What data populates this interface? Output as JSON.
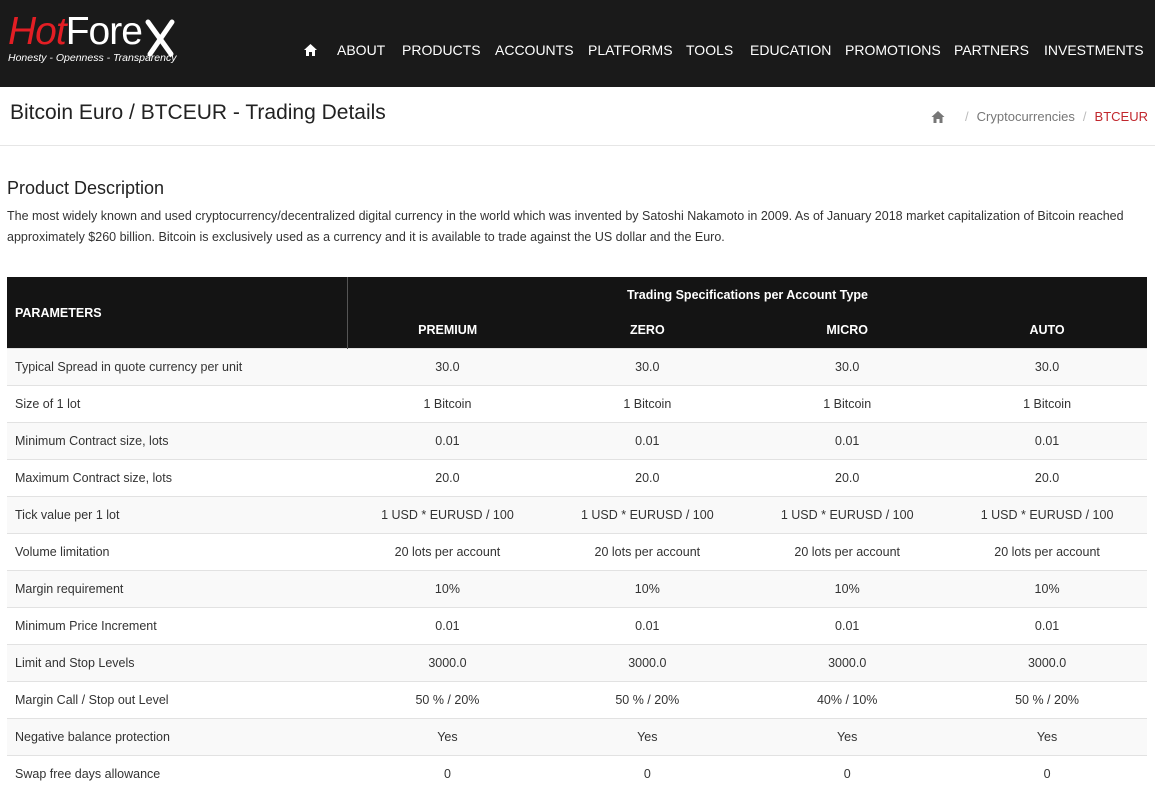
{
  "brand": {
    "logo_hot": "Hot",
    "logo_forex": "Fore",
    "logo_x": "X",
    "tagline": "Honesty - Openness - Transparency"
  },
  "nav": {
    "home_icon": "home-icon",
    "items": [
      "ABOUT",
      "PRODUCTS",
      "ACCOUNTS",
      "PLATFORMS",
      "TOOLS",
      "EDUCATION",
      "PROMOTIONS",
      "PARTNERS",
      "INVESTMENTS"
    ]
  },
  "page": {
    "title": "Bitcoin Euro / BTCEUR - Trading Details"
  },
  "breadcrumb": {
    "home_icon": "home-icon",
    "separator": "/",
    "items": [
      "Cryptocurrencies",
      "BTCEUR"
    ]
  },
  "description": {
    "heading": "Product Description",
    "text": "The most widely known and used cryptocurrency/decentralized digital currency in the world which was invented by Satoshi Nakamoto in 2009. As of January 2018 market capitalization of Bitcoin reached approximately $260 billion. Bitcoin is exclusively used as a currency and it is available to trade against the US dollar and the Euro."
  },
  "table": {
    "params_header": "PARAMETERS",
    "group_header": "Trading Specifications per Account Type",
    "columns": [
      "PREMIUM",
      "ZERO",
      "MICRO",
      "AUTO"
    ],
    "rows": [
      {
        "param": "Typical Spread in quote currency per unit",
        "values": [
          "30.0",
          "30.0",
          "30.0",
          "30.0"
        ]
      },
      {
        "param": "Size of 1 lot",
        "values": [
          "1 Bitcoin",
          "1 Bitcoin",
          "1 Bitcoin",
          "1 Bitcoin"
        ]
      },
      {
        "param": "Minimum Contract size, lots",
        "values": [
          "0.01",
          "0.01",
          "0.01",
          "0.01"
        ]
      },
      {
        "param": "Maximum Contract size, lots",
        "values": [
          "20.0",
          "20.0",
          "20.0",
          "20.0"
        ]
      },
      {
        "param": "Tick value per 1 lot",
        "values": [
          "1 USD * EURUSD / 100",
          "1 USD * EURUSD / 100",
          "1 USD * EURUSD / 100",
          "1 USD * EURUSD / 100"
        ]
      },
      {
        "param": "Volume limitation",
        "values": [
          "20 lots per account",
          "20 lots per account",
          "20 lots per account",
          "20 lots per account"
        ]
      },
      {
        "param": "Margin requirement",
        "values": [
          "10%",
          "10%",
          "10%",
          "10%"
        ]
      },
      {
        "param": "Minimum Price Increment",
        "values": [
          "0.01",
          "0.01",
          "0.01",
          "0.01"
        ]
      },
      {
        "param": "Limit and Stop Levels",
        "values": [
          "3000.0",
          "3000.0",
          "3000.0",
          "3000.0"
        ]
      },
      {
        "param": "Margin Call / Stop out Level",
        "values": [
          "50 % / 20%",
          "50 % / 20%",
          "40% / 10%",
          "50 % / 20%"
        ]
      },
      {
        "param": "Negative balance protection",
        "values": [
          "Yes",
          "Yes",
          "Yes",
          "Yes"
        ]
      },
      {
        "param": "Swap free days allowance",
        "values": [
          "0",
          "0",
          "0",
          "0"
        ]
      }
    ]
  },
  "colors": {
    "header_bg": "#1a1a1a",
    "brand_red": "#e31e24",
    "breadcrumb_active": "#c1272d",
    "table_header_bg": "#141414"
  }
}
